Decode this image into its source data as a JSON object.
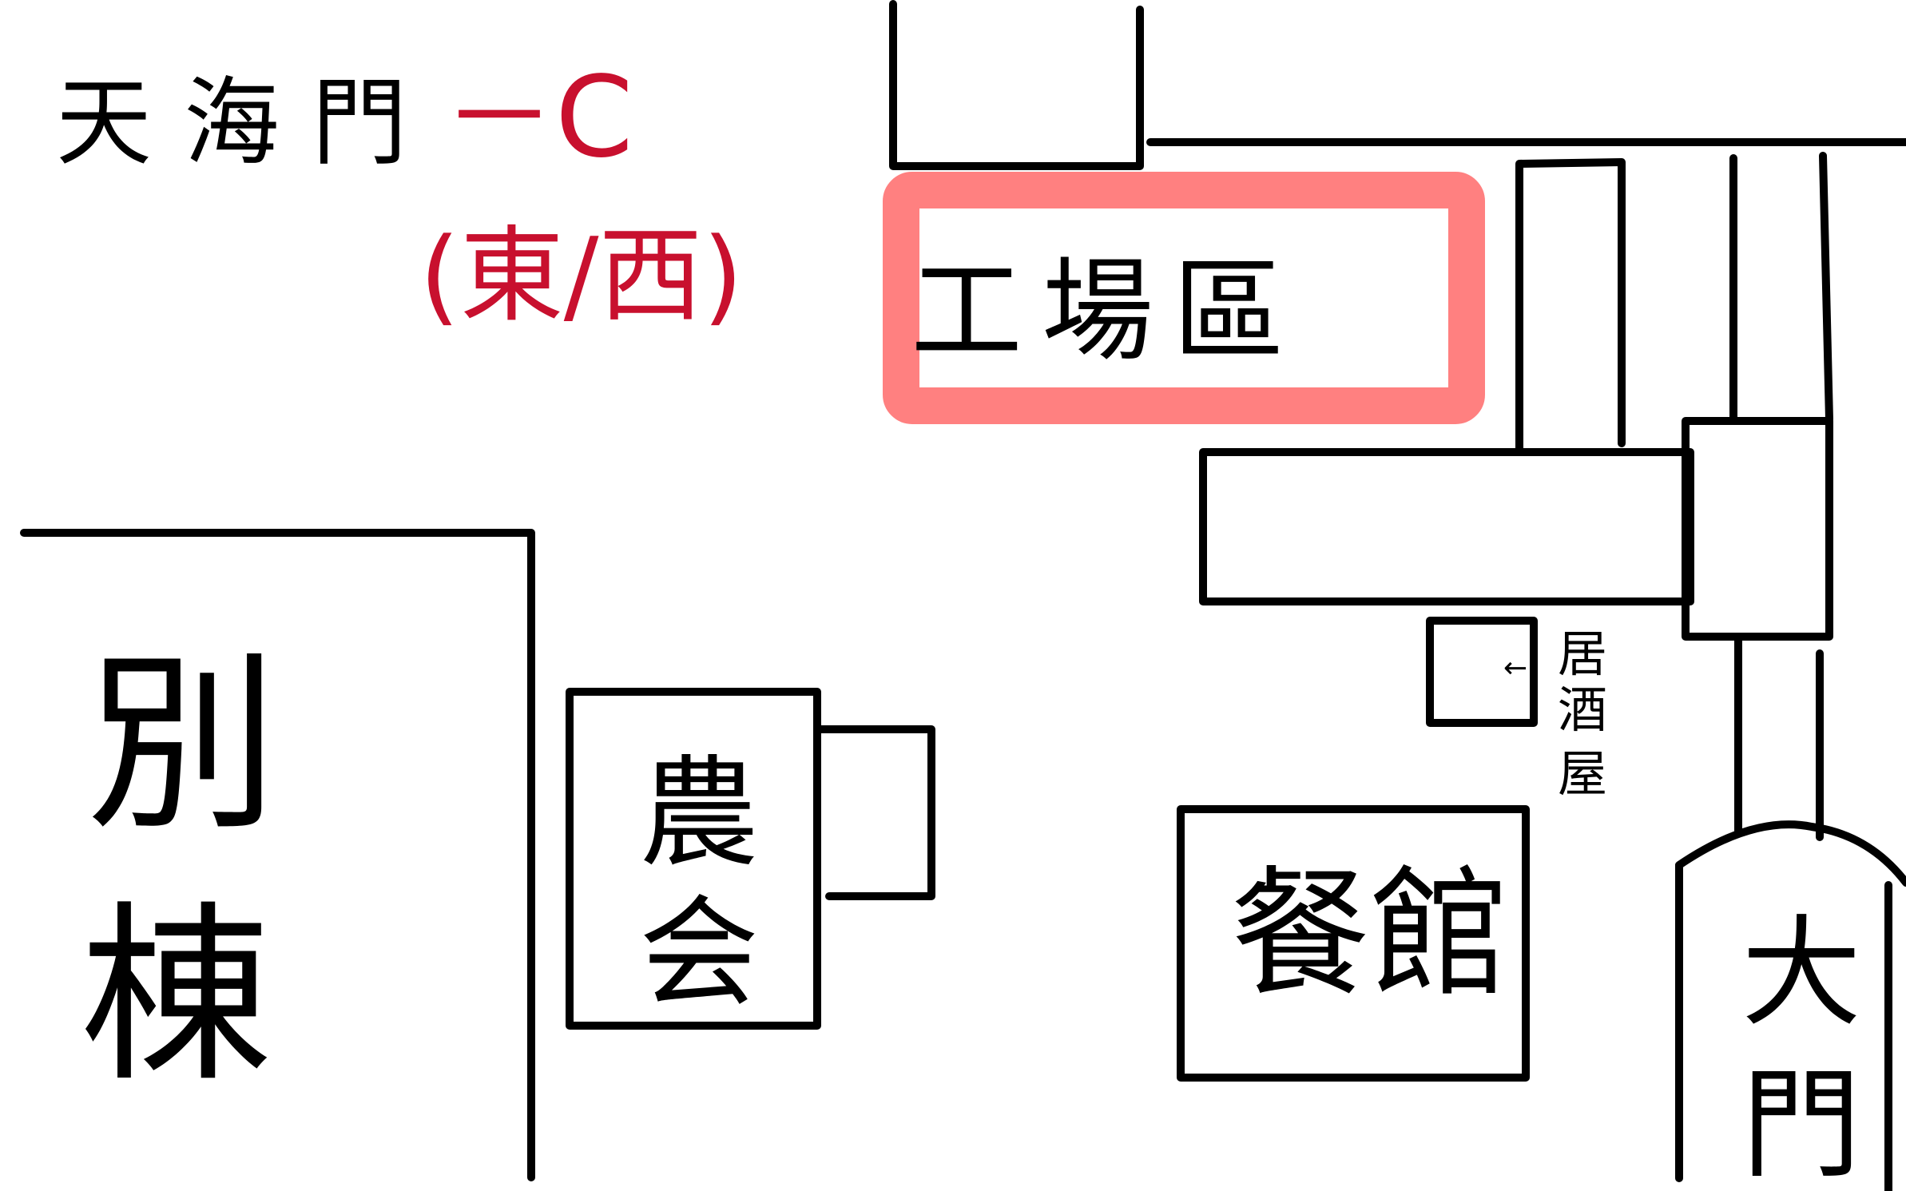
{
  "map": {
    "title": "天海門",
    "route_suffix": "－C",
    "direction_note": "(東/西)",
    "highlight_color": "#ff8080",
    "note_color": "#c8102e",
    "areas": {
      "factory": "工場區",
      "annex_char1": "別",
      "annex_char2": "棟",
      "hall_char1": "農",
      "hall_char2": "会",
      "restaurant": "餐館",
      "izakaya_char1": "居",
      "izakaya_char2": "酒",
      "izakaya_char3": "屋",
      "gate_char1": "大",
      "gate_char2": "門"
    }
  }
}
